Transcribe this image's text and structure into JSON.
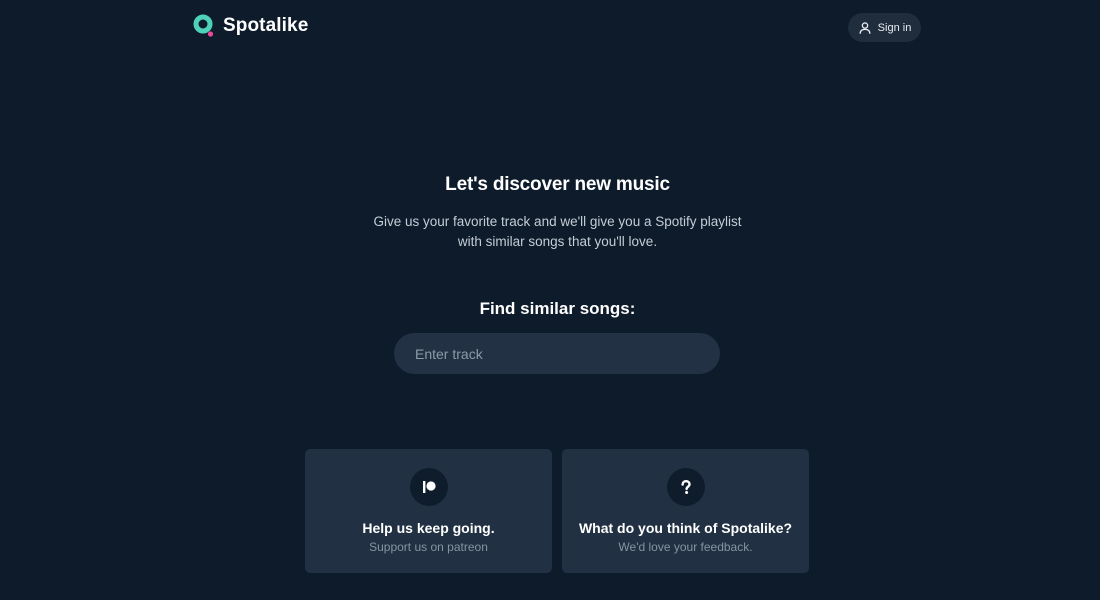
{
  "header": {
    "app_name": "Spotalike",
    "signin_label": "Sign in"
  },
  "hero": {
    "title": "Let's discover new music",
    "subtitle_line1": "Give us your favorite track and we'll give you a Spotify playlist",
    "subtitle_line2": "with similar songs that you'll love."
  },
  "search": {
    "label": "Find similar songs:",
    "placeholder": "Enter track",
    "value": ""
  },
  "cards": [
    {
      "icon": "patreon-icon",
      "title": "Help us keep going.",
      "subtitle": "Support us on patreon"
    },
    {
      "icon": "question-icon",
      "title": "What do you think of Spotalike?",
      "subtitle": "We'd love your feedback."
    }
  ],
  "colors": {
    "background": "#0d1b2a",
    "surface": "#213143",
    "input": "#223244",
    "brand_teal": "#4fd1b8",
    "brand_pink": "#ec4899",
    "muted_text": "#8693a0"
  }
}
